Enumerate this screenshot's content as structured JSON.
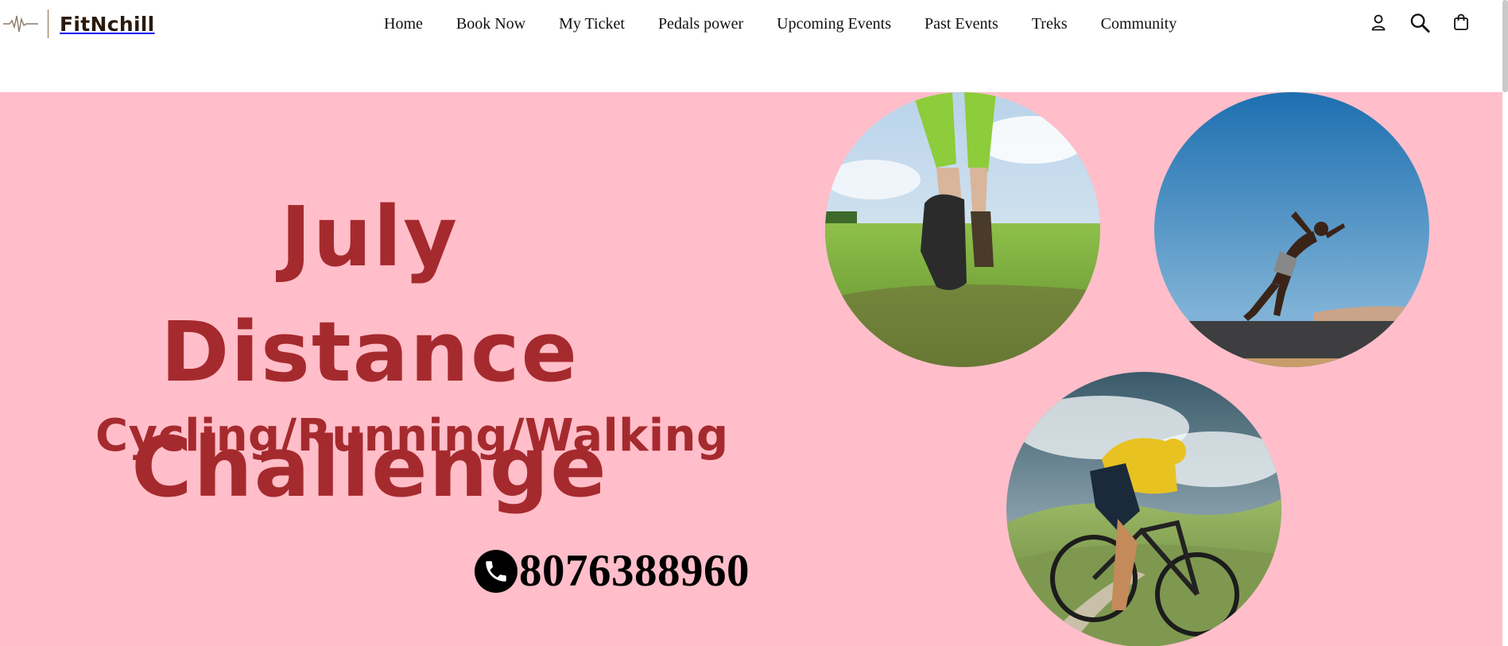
{
  "brand": {
    "name": "FitNchill"
  },
  "nav": {
    "items": [
      {
        "label": "Home"
      },
      {
        "label": "Book Now"
      },
      {
        "label": "My Ticket"
      },
      {
        "label": "Pedals power"
      },
      {
        "label": "Upcoming Events"
      },
      {
        "label": "Past Events"
      },
      {
        "label": "Treks"
      },
      {
        "label": "Community"
      }
    ]
  },
  "header_icons": [
    "account-icon",
    "search-icon",
    "cart-icon"
  ],
  "hero": {
    "title_line1": "July Distance",
    "title_line2": "Challenge",
    "subtitle": "Cycling/Running/Walking",
    "phone": "8076388960",
    "images": [
      "hiking-photo",
      "sprinter-photo",
      "cyclist-photo"
    ]
  },
  "colors": {
    "hero_background": "#ffbec9",
    "title_text": "#a52a2e",
    "brand_text": "#2a1a0e"
  }
}
